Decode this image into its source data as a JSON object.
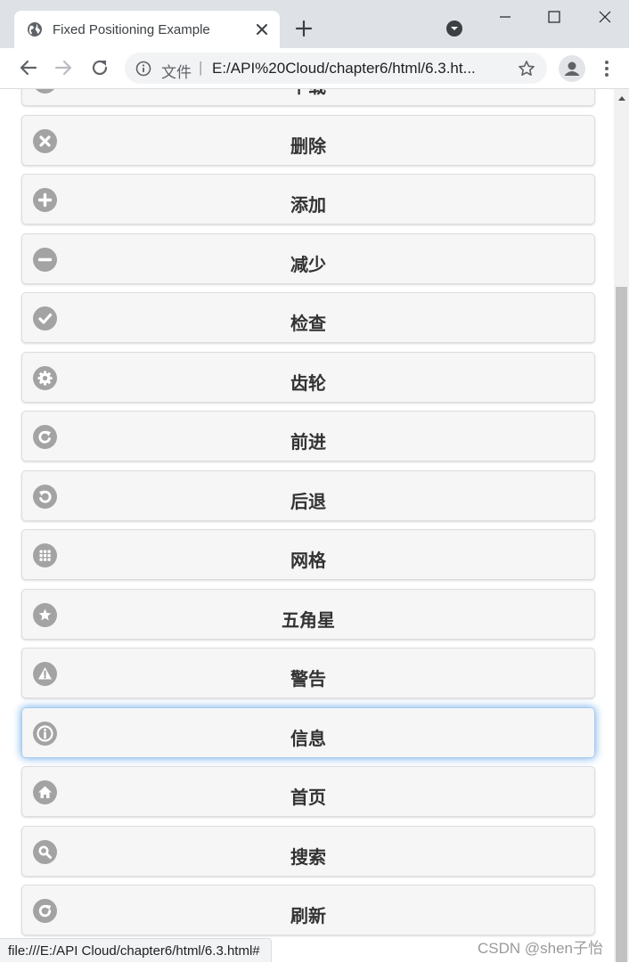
{
  "tab": {
    "title": "Fixed Positioning Example"
  },
  "address_bar": {
    "security_label": "文件",
    "separator": "|",
    "url": "E:/API%20Cloud/chapter6/html/6.3.ht..."
  },
  "buttons": [
    {
      "label": "下载",
      "icon": "download-icon"
    },
    {
      "label": "删除",
      "icon": "delete-icon"
    },
    {
      "label": "添加",
      "icon": "plus-icon"
    },
    {
      "label": "减少",
      "icon": "minus-icon"
    },
    {
      "label": "检查",
      "icon": "check-icon"
    },
    {
      "label": "齿轮",
      "icon": "gear-icon"
    },
    {
      "label": "前进",
      "icon": "forward-icon"
    },
    {
      "label": "后退",
      "icon": "back-icon"
    },
    {
      "label": "网格",
      "icon": "grid-icon"
    },
    {
      "label": "五角星",
      "icon": "star-icon"
    },
    {
      "label": "警告",
      "icon": "alert-icon"
    },
    {
      "label": "信息",
      "icon": "info-icon",
      "focused": true
    },
    {
      "label": "首页",
      "icon": "home-icon"
    },
    {
      "label": "搜索",
      "icon": "search-icon"
    },
    {
      "label": "刷新",
      "icon": "refresh-icon"
    }
  ],
  "status_bar": {
    "text": "file:///E:/API Cloud/chapter6/html/6.3.html#"
  },
  "watermark": {
    "text": "CSDN @shen子怡"
  },
  "colors": {
    "icon_gray": "#a3a3a3",
    "focus_glow": "#6aa6e5"
  }
}
